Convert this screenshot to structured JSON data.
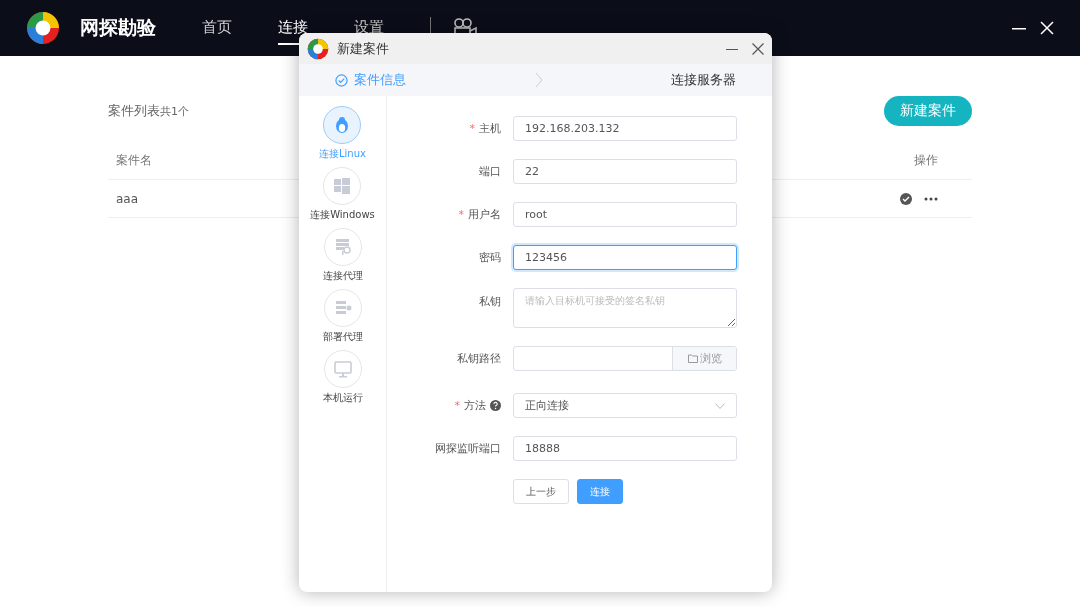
{
  "app": {
    "title": "网探勘验",
    "nav": [
      {
        "label": "首页",
        "selected": false
      },
      {
        "label": "连接",
        "selected": true
      },
      {
        "label": "设置",
        "selected": false
      }
    ]
  },
  "case_list": {
    "title": "案件列表",
    "count": "共1个",
    "new_button": "新建案件",
    "columns": [
      "案件名",
      "操作"
    ],
    "rows": [
      {
        "name": "aaa",
        "checked": true
      }
    ]
  },
  "dialog": {
    "title": "新建案件",
    "steps": [
      {
        "label": "案件信息",
        "done": true
      },
      {
        "label": "连接服务器",
        "done": false
      }
    ],
    "modes": [
      {
        "label": "连接Linux",
        "kind": "linux",
        "selected": true
      },
      {
        "label": "连接Windows",
        "kind": "windows",
        "selected": false
      },
      {
        "label": "连接代理",
        "kind": "proxy",
        "selected": false
      },
      {
        "label": "部署代理",
        "kind": "deploy",
        "selected": false
      },
      {
        "label": "本机运行",
        "kind": "local",
        "selected": false
      }
    ],
    "fields": [
      {
        "label": "主机",
        "kind": "text",
        "mark": "*",
        "value": "192.168.203.132",
        "focused": false
      },
      {
        "label": "端口",
        "kind": "text",
        "value": "22",
        "focused": false
      },
      {
        "label": "用户名",
        "kind": "text",
        "mark": "*",
        "value": "root",
        "focused": false
      },
      {
        "label": "密码",
        "kind": "text",
        "value": "123456",
        "focused": true
      },
      {
        "label": "私钥",
        "kind": "textarea",
        "placeholder": "请输入目标机可接受的签名私钥"
      },
      {
        "label": "私钥路径",
        "kind": "file",
        "button": "浏览"
      },
      {
        "label": "方法",
        "kind": "select",
        "mark": "*",
        "help": true,
        "value": "正向连接"
      },
      {
        "label": "网探监听端口",
        "kind": "text",
        "value": "18888",
        "focused": false
      }
    ],
    "buttons": [
      {
        "label": "上一步",
        "primary": false
      },
      {
        "label": "连接",
        "primary": true
      }
    ]
  }
}
